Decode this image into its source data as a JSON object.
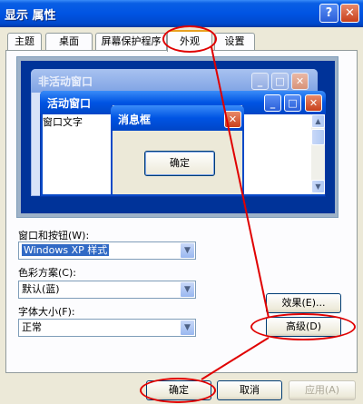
{
  "window": {
    "title": "显示 属性",
    "help_label": "?",
    "close_label": "✕"
  },
  "tabs": [
    {
      "label": "主题",
      "active": false
    },
    {
      "label": "桌面",
      "active": false
    },
    {
      "label": "屏幕保护程序",
      "active": false
    },
    {
      "label": "外观",
      "active": true
    },
    {
      "label": "设置",
      "active": false
    }
  ],
  "preview": {
    "inactive_title": "非活动窗口",
    "active_title": "活动窗口",
    "window_text": "窗口文字",
    "message_title": "消息框",
    "message_ok": "确定",
    "min_glyph": "_",
    "max_glyph": "□",
    "close_glyph": "✕",
    "scroll_up_glyph": "▲",
    "scroll_down_glyph": "▼"
  },
  "form": {
    "windows_buttons_label": "窗口和按钮(W):",
    "windows_buttons_value": "Windows XP 样式",
    "color_scheme_label": "色彩方案(C):",
    "color_scheme_value": "默认(蓝)",
    "font_size_label": "字体大小(F):",
    "font_size_value": "正常",
    "dropdown_glyph": "▼"
  },
  "buttons": {
    "effects": "效果(E)...",
    "advanced": "高级(D)",
    "ok": "确定",
    "cancel": "取消",
    "apply": "应用(A)"
  },
  "colors": {
    "titlebar": "#0054e3",
    "dialog_bg": "#ece9d8",
    "preview_desktop": "#003399",
    "annotation": "#e00000"
  }
}
